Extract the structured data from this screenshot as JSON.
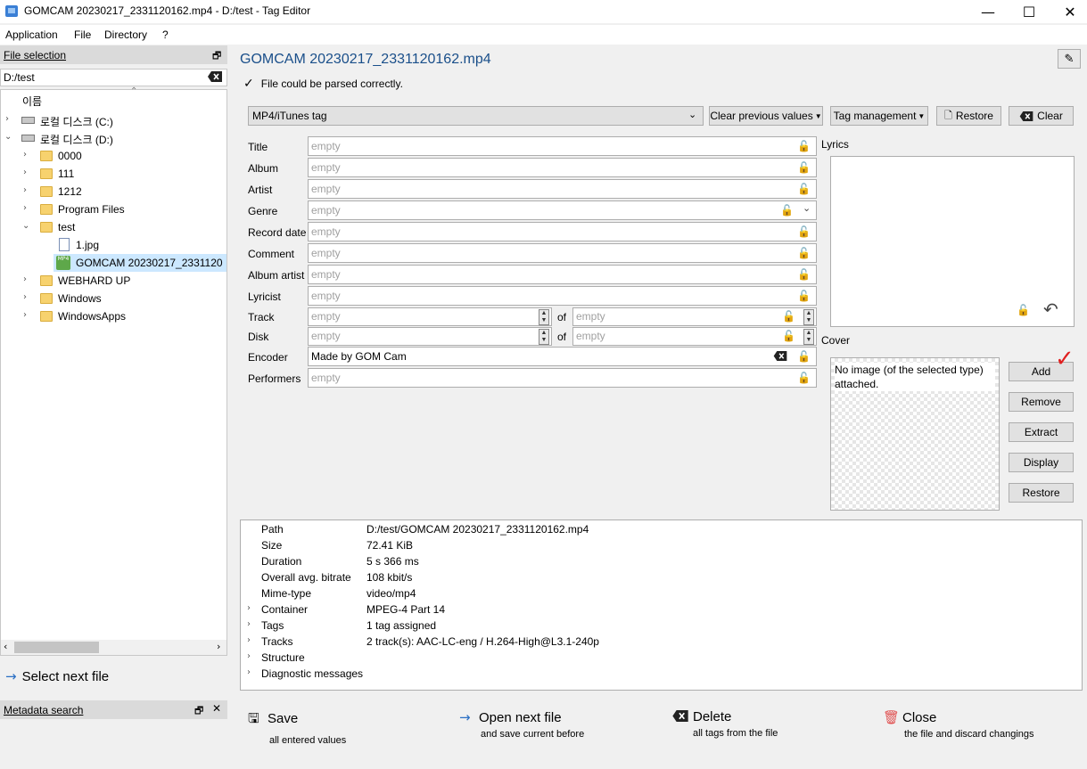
{
  "window": {
    "title": "GOMCAM 20230217_2331120162.mp4 - D:/test - Tag Editor",
    "minimize": "—",
    "maximize": "☐",
    "close": "✕"
  },
  "menu": [
    "Application",
    "File",
    "Directory",
    "?"
  ],
  "file_selection": {
    "title": "File selection",
    "path": "D:/test",
    "column_header": "이름",
    "tree": [
      {
        "label": "로컬 디스크 (C:)",
        "type": "drive",
        "expanded": false
      },
      {
        "label": "로컬 디스크 (D:)",
        "type": "drive",
        "expanded": true
      },
      {
        "label": "0000",
        "type": "folder"
      },
      {
        "label": "111",
        "type": "folder"
      },
      {
        "label": "1212",
        "type": "folder"
      },
      {
        "label": "Program Files",
        "type": "folder"
      },
      {
        "label": "test",
        "type": "folder",
        "expanded": true
      },
      {
        "label": "1.jpg",
        "type": "file"
      },
      {
        "label": "GOMCAM 20230217_2331120",
        "type": "file-mp4",
        "selected": true
      },
      {
        "label": "WEBHARD UP",
        "type": "folder"
      },
      {
        "label": "Windows",
        "type": "folder"
      },
      {
        "label": "WindowsApps",
        "type": "folder"
      }
    ],
    "select_next": "Select next file"
  },
  "metadata_search": {
    "title": "Metadata search"
  },
  "editor": {
    "file_title": "GOMCAM 20230217_2331120162.mp4",
    "status": "File could be parsed correctly.",
    "tag_type": "MP4/iTunes tag",
    "buttons": {
      "clear_previous": "Clear previous values",
      "tag_management": "Tag management",
      "restore": "Restore",
      "clear": "Clear"
    },
    "fields": [
      {
        "label": "Title",
        "value": "",
        "placeholder": "empty"
      },
      {
        "label": "Album",
        "value": "",
        "placeholder": "empty"
      },
      {
        "label": "Artist",
        "value": "",
        "placeholder": "empty"
      },
      {
        "label": "Genre",
        "value": "",
        "placeholder": "empty"
      },
      {
        "label": "Record date",
        "value": "",
        "placeholder": "empty"
      },
      {
        "label": "Comment",
        "value": "",
        "placeholder": "empty"
      },
      {
        "label": "Album artist",
        "value": "",
        "placeholder": "empty"
      },
      {
        "label": "Lyricist",
        "value": "",
        "placeholder": "empty"
      },
      {
        "label": "Track",
        "value": "",
        "placeholder": "empty",
        "of_placeholder": "empty"
      },
      {
        "label": "Disk",
        "value": "",
        "placeholder": "empty",
        "of_placeholder": "empty"
      },
      {
        "label": "Encoder",
        "value": "Made by GOM Cam",
        "placeholder": "empty"
      },
      {
        "label": "Performers",
        "value": "",
        "placeholder": "empty"
      }
    ],
    "of_label": "of",
    "lyrics_label": "Lyrics",
    "cover_label": "Cover",
    "cover_text": "No image (of the selected type) attached.",
    "cover_buttons": [
      "Add",
      "Remove",
      "Extract",
      "Display",
      "Restore"
    ]
  },
  "info": [
    {
      "key": "Path",
      "value": "D:/test/GOMCAM 20230217_2331120162.mp4",
      "expandable": false
    },
    {
      "key": "Size",
      "value": "72.41 KiB",
      "expandable": false
    },
    {
      "key": "Duration",
      "value": "5 s 366 ms",
      "expandable": false
    },
    {
      "key": "Overall avg. bitrate",
      "value": "108 kbit/s",
      "expandable": false
    },
    {
      "key": "Mime-type",
      "value": "video/mp4",
      "expandable": false
    },
    {
      "key": "Container",
      "value": "MPEG-4 Part 14",
      "expandable": true
    },
    {
      "key": "Tags",
      "value": "1 tag assigned",
      "expandable": true
    },
    {
      "key": "Tracks",
      "value": "2 track(s): AAC-LC-eng / H.264-High@L3.1-240p",
      "expandable": true
    },
    {
      "key": "Structure",
      "value": "",
      "expandable": true
    },
    {
      "key": "Diagnostic messages",
      "value": "",
      "expandable": true
    }
  ],
  "actions": [
    {
      "icon": "save-icon",
      "label": "Save",
      "sub": "all entered values"
    },
    {
      "icon": "arrow-right-icon",
      "label": "Open next file",
      "sub": "and save current before"
    },
    {
      "icon": "delete-icon",
      "label": "Delete",
      "sub": "all tags from the file"
    },
    {
      "icon": "trash-icon",
      "label": "Close",
      "sub": "the file and discard changings"
    }
  ]
}
